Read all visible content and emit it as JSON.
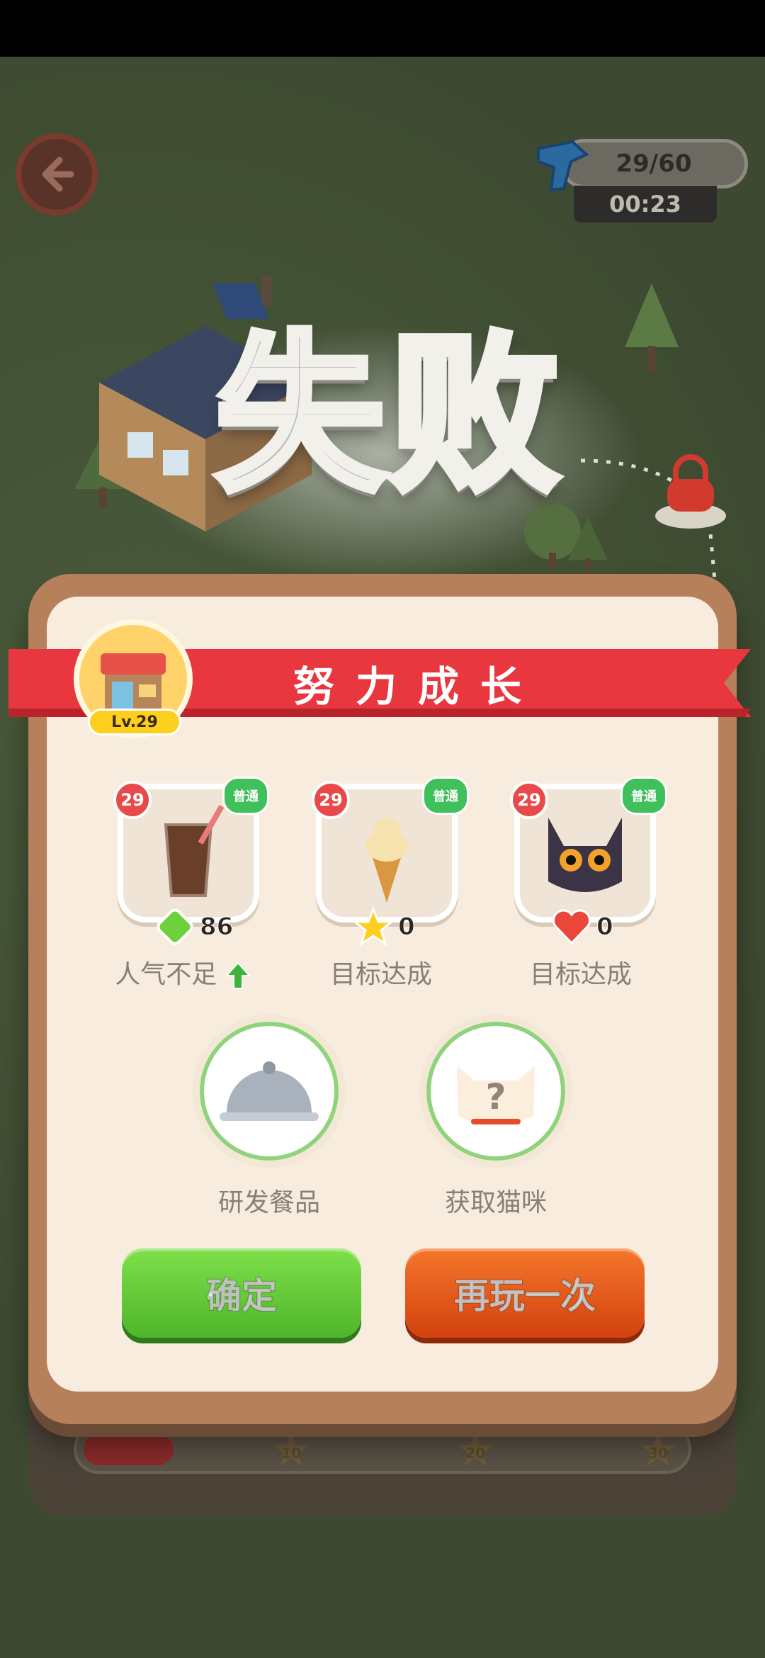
{
  "header": {
    "progress_text": "29/60",
    "timer_text": "00:23"
  },
  "result": {
    "title": "失败",
    "banner_text": "努力成长",
    "level_tag": "Lv.29"
  },
  "cards": [
    {
      "level": "29",
      "rarity": "普通",
      "stat_value": "86",
      "label": "人气不足"
    },
    {
      "level": "29",
      "rarity": "普通",
      "stat_value": "0",
      "label": "目标达成"
    },
    {
      "level": "29",
      "rarity": "普通",
      "stat_value": "0",
      "label": "目标达成"
    }
  ],
  "actions": {
    "develop_label": "研发餐品",
    "cat_label": "获取猫咪",
    "confirm_label": "确定",
    "retry_label": "再玩一次"
  },
  "bottom_progress": {
    "fraction": 0.15,
    "milestones": [
      "10",
      "20",
      "30"
    ]
  },
  "icons": {
    "back": "back-arrow-icon",
    "boot": "boot-icon",
    "popularity": "green-gem-icon",
    "goal_star": "star-icon",
    "goal_heart": "heart-icon",
    "up": "up-arrow-icon",
    "develop": "cloche-icon",
    "cat": "mystery-cat-icon"
  },
  "colors": {
    "banner": "#e9373f",
    "confirm": "#5cc133",
    "retry": "#e05419",
    "gem": "#6ed13c"
  }
}
